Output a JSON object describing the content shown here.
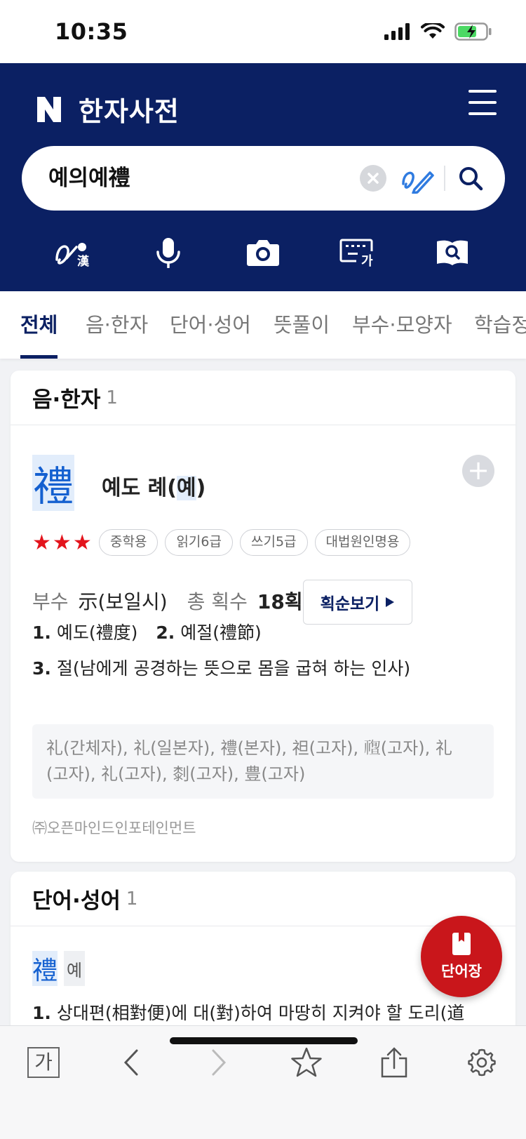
{
  "status": {
    "time": "10:35"
  },
  "header": {
    "title": "한자사전",
    "logo_letter": "N"
  },
  "search": {
    "query": "예의예禮"
  },
  "tools": [
    {
      "icon": "handwriting-hanja-icon"
    },
    {
      "icon": "microphone-icon"
    },
    {
      "icon": "camera-icon"
    },
    {
      "icon": "keyboard-icon",
      "label": "가"
    },
    {
      "icon": "book-search-icon"
    }
  ],
  "tabs": [
    "전체",
    "음·한자",
    "단어·성어",
    "뜻풀이",
    "부수·모양자",
    "학습정"
  ],
  "hanja_section": {
    "title": "음·한자",
    "count": "1",
    "character": "禮",
    "reading_main": "예도 례(",
    "reading_hl": "예",
    "reading_end": ")",
    "add": "+",
    "rating": 3,
    "badges": [
      "중학용",
      "읽기6급",
      "쓰기5급",
      "대법원인명용"
    ],
    "radical_label": "부수",
    "radical_value": "示(보일시)",
    "strokes_label": "총 획수",
    "strokes_value": "18획",
    "stroke_button": "획순보기",
    "definitions": [
      {
        "num": "1.",
        "text": "예도(禮度)"
      },
      {
        "num": "2.",
        "text": "예절(禮節)"
      },
      {
        "num": "3.",
        "text": "절(남에게 공경하는 뜻으로 몸을 굽혀 하는 인사)"
      }
    ],
    "variants_line1": "礼(간체자), 礼(일본자), 禮(본자), 𥘵(고자), 𥛠(고자), 礼",
    "variants_line2": "(고자), 礼(고자), 㓼(고자), 豊(고자)",
    "copyright": "㈜오픈마인드인포테인먼트"
  },
  "word_section": {
    "title": "단어·성어",
    "count": "1",
    "hanja": "禮",
    "reading": "예",
    "definition_num": "1.",
    "definition": "상대편(相對便)에 대(對)하여 마땅히 지켜야 할 도리(道"
  },
  "fab": {
    "label": "단어장"
  },
  "bottom_bar": {
    "font_label": "가"
  },
  "colors": {
    "brand": "#0b2063",
    "accent": "#1460d0",
    "fab": "#c9161b",
    "star": "#e3141c"
  }
}
